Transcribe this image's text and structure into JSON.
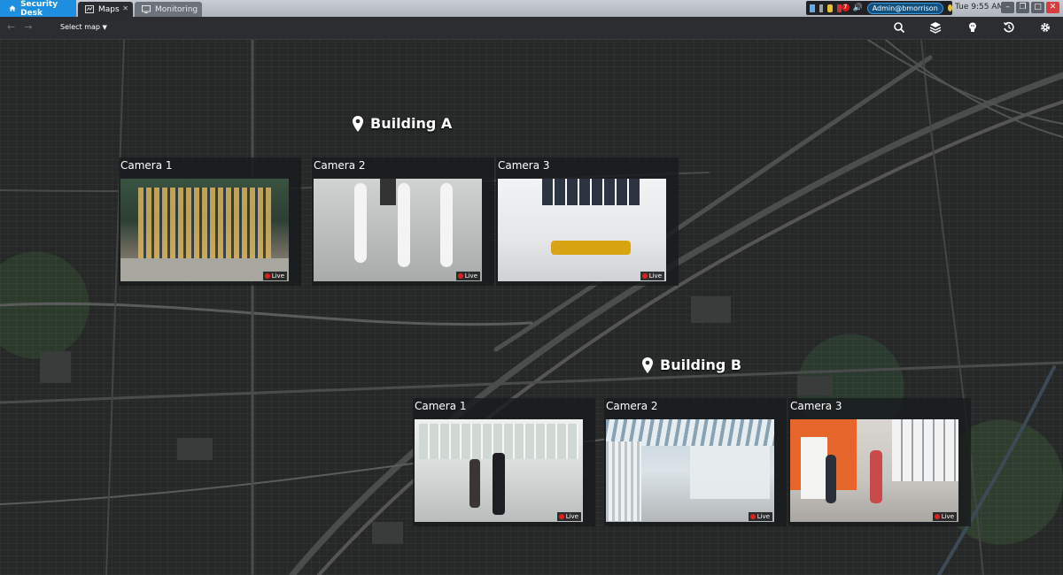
{
  "app": {
    "home_tab": "Security Desk",
    "tabs": [
      {
        "label": "Maps",
        "active": true
      },
      {
        "label": "Monitoring",
        "active": false
      }
    ]
  },
  "tray": {
    "alert_count": "7",
    "user": "Admin@bmorrison",
    "clock": "Tue 9:55 AM"
  },
  "toolbar": {
    "select_map": "Select map"
  },
  "map": {
    "buildings": [
      {
        "name": "Building A",
        "cameras": [
          {
            "name": "Camera 1",
            "status": "Live"
          },
          {
            "name": "Camera 2",
            "status": "Live"
          },
          {
            "name": "Camera 3",
            "status": "Live"
          }
        ]
      },
      {
        "name": "Building B",
        "cameras": [
          {
            "name": "Camera 1",
            "status": "Live"
          },
          {
            "name": "Camera 2",
            "status": "Live"
          },
          {
            "name": "Camera 3",
            "status": "Live"
          }
        ]
      }
    ]
  },
  "colors": {
    "accent": "#1e8fe0",
    "live_dot": "#e02020"
  }
}
